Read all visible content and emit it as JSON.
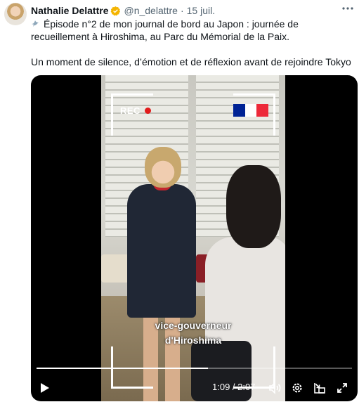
{
  "tweet": {
    "author": {
      "name": "Nathalie Delattre",
      "handle": "@n_delattre",
      "separator": "·",
      "date": "15 juil."
    },
    "more_icon": "more-horizontal-icon",
    "verified_color": "#f4b400",
    "paragraph1": "Épisode n°2 de mon journal de bord au Japon : journée de recueillement à Hiroshima, au Parc du Mémorial de la Paix.",
    "paragraph2": "Un moment de silence, d’émotion et de réflexion avant de rejoindre Tokyo"
  },
  "video": {
    "rec_label": "REC",
    "flag_colors": [
      "#002395",
      "#ffffff",
      "#ed2939"
    ],
    "caption_line1": "vice-gouverneur",
    "caption_line2": "d'Hiroshima",
    "time_display": "1:09 / 2:07",
    "progress": 0.543,
    "controls": [
      "play-icon",
      "volume-icon",
      "settings-icon",
      "picture-in-picture-icon",
      "fullscreen-icon"
    ]
  }
}
